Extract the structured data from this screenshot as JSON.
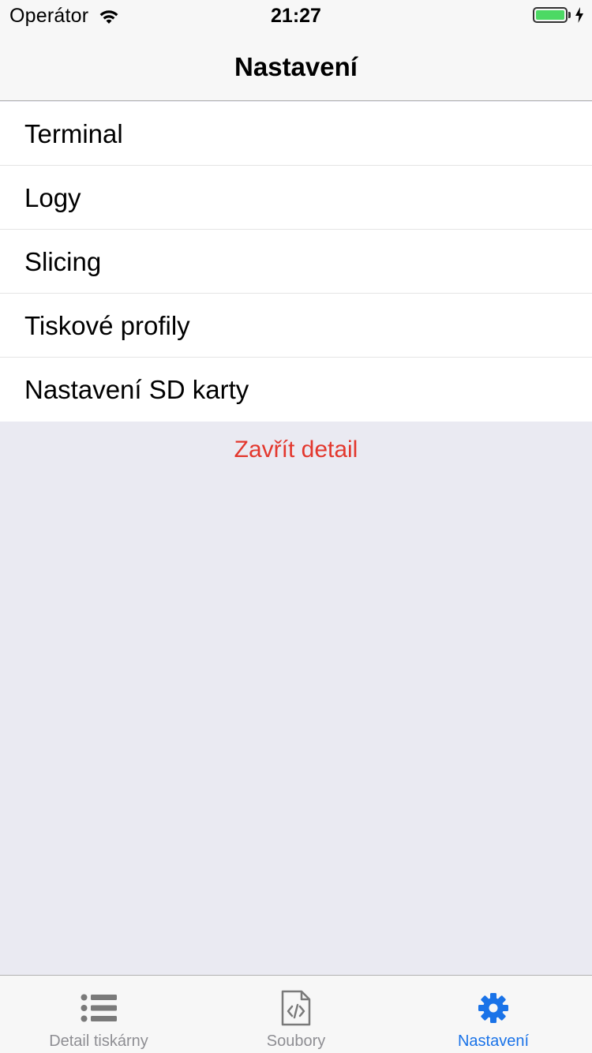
{
  "status_bar": {
    "carrier": "Operátor",
    "time": "21:27",
    "battery_level": 1.0,
    "charging": true
  },
  "nav": {
    "title": "Nastavení"
  },
  "settings": {
    "items": [
      {
        "label": "Terminal"
      },
      {
        "label": "Logy"
      },
      {
        "label": "Slicing"
      },
      {
        "label": "Tiskové profily"
      },
      {
        "label": "Nastavení SD karty"
      }
    ]
  },
  "close_button": {
    "label": "Zavřít detail"
  },
  "tabs": [
    {
      "label": "Detail tiskárny",
      "icon": "list-icon",
      "active": false
    },
    {
      "label": "Soubory",
      "icon": "code-file-icon",
      "active": false
    },
    {
      "label": "Nastavení",
      "icon": "gear-icon",
      "active": true
    }
  ],
  "colors": {
    "accent": "#1A73E8",
    "destructive": "#E3372D",
    "background": "#EAEAF2",
    "battery": "#4CD964",
    "inactive_tab": "#8E8E93"
  }
}
